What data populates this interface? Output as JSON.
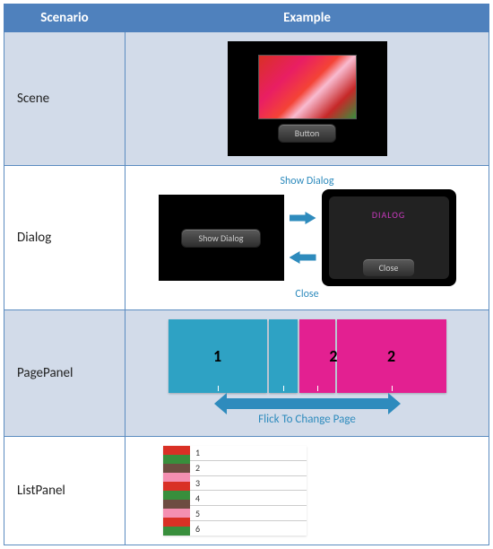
{
  "headers": {
    "scenario": "Scenario",
    "example": "Example"
  },
  "rows": {
    "scene": {
      "label": "Scene",
      "button": "Button"
    },
    "dialog": {
      "label": "Dialog",
      "show_btn": "Show Dialog",
      "close_btn": "Close",
      "show_label": "Show Dialog",
      "close_label": "Close",
      "dialog_title": "DIALOG"
    },
    "pagepanel": {
      "label": "PagePanel",
      "p1": "1",
      "p2": "2",
      "flick": "Flick To Change Page"
    },
    "listpanel": {
      "label": "ListPanel",
      "items": [
        "1",
        "2",
        "3",
        "4",
        "5",
        "6"
      ]
    }
  }
}
